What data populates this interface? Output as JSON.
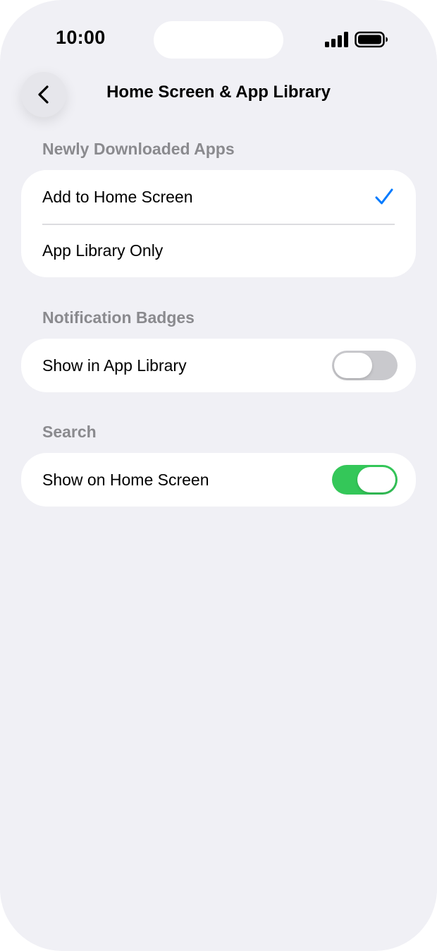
{
  "status_bar": {
    "time": "10:00",
    "icons": [
      "cellular-signal-icon",
      "battery-icon"
    ]
  },
  "nav": {
    "back_icon": "chevron-left-icon",
    "title": "Home Screen & App Library"
  },
  "sections": [
    {
      "header": "Newly Downloaded Apps",
      "rows": [
        {
          "label": "Add to Home Screen",
          "selected": true
        },
        {
          "label": "App Library Only",
          "selected": false
        }
      ]
    },
    {
      "header": "Notification Badges",
      "rows": [
        {
          "label": "Show in App Library",
          "toggle": false
        }
      ]
    },
    {
      "header": "Search",
      "rows": [
        {
          "label": "Show on Home Screen",
          "toggle": true
        }
      ]
    }
  ],
  "colors": {
    "background": "#f0f0f5",
    "accent_blue": "#007aff",
    "toggle_on": "#34c759",
    "toggle_off": "#c9c9cd",
    "section_header": "#8a8a8e"
  }
}
